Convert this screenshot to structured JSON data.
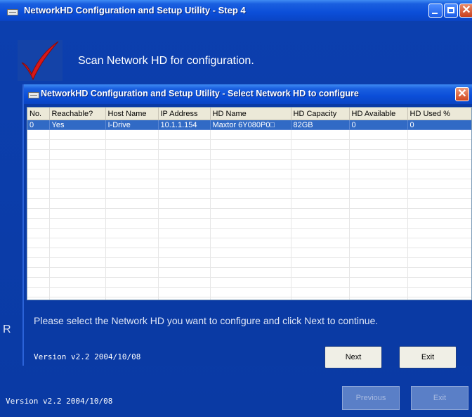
{
  "window": {
    "title": "NetworkHD Configuration and Setup Utility - Step 4",
    "heading": "Scan Network HD for configuration.",
    "partial_label": "R",
    "version": "Version v2.2  2004/10/08",
    "previous_label": "Previous",
    "exit_label": "Exit"
  },
  "dialog": {
    "title": "NetworkHD Configuration and Setup Utility - Select Network HD to configure",
    "columns": [
      "No.",
      "Reachable?",
      "Host Name",
      "IP Address",
      "HD Name",
      "HD Capacity",
      "HD Available",
      "HD Used %"
    ],
    "rows": [
      [
        "0",
        "Yes",
        "I-Drive",
        "10.1.1.154",
        "Maxtor 6Y080P0□",
        "82GB",
        "0",
        "0"
      ]
    ],
    "instruction": "Please select the Network HD you want to configure and click Next to continue.",
    "version": "Version v2.2  2004/10/08",
    "next_label": "Next",
    "exit_label": "Exit"
  },
  "colors": {
    "background": "#0a3aa4",
    "titlebar": "#0b4ed8",
    "selection": "#316ac5"
  },
  "icons": {
    "app": "drive-icon",
    "logo": "red-checkmark-icon"
  }
}
